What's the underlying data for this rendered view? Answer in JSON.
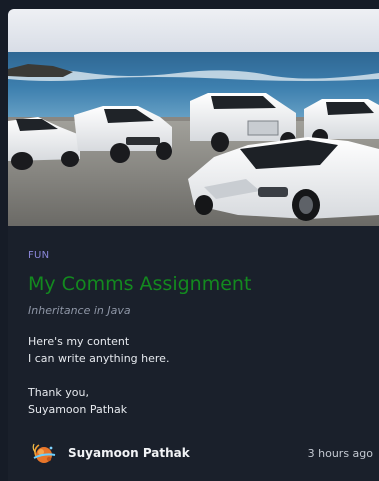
{
  "post": {
    "category": "FUN",
    "title": "My Comms Assignment",
    "subtitle": "Inheritance in Java",
    "content_lines": [
      "Here's my content",
      "I can write anything here.",
      "",
      "Thank you,",
      "Suyamoon Pathak"
    ],
    "author": "Suyamoon Pathak",
    "time": "3 hours ago",
    "image_icon": "cars-on-beach-photo",
    "avatar_icon": "planet-avatar-icon"
  },
  "colors": {
    "page_bg": "#161c27",
    "card_bg": "#1a202b",
    "category": "#8a86d8",
    "title": "#138a1f",
    "subtitle": "#8e96a6",
    "text": "#e6e9ee"
  }
}
